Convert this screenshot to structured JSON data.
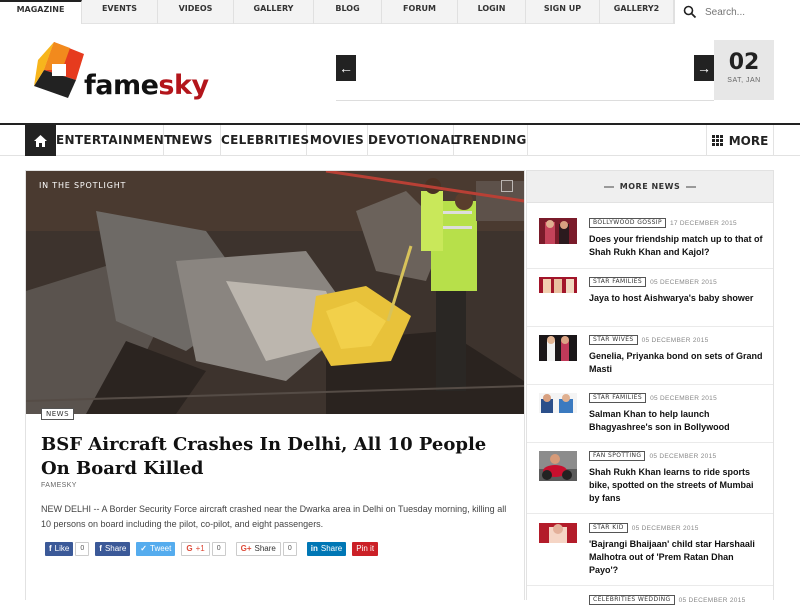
{
  "topnav": {
    "items": [
      "MAGAZINE",
      "EVENTS",
      "VIDEOS",
      "GALLERY",
      "BLOG",
      "FORUM",
      "LOGIN",
      "SIGN UP",
      "GALLERY2"
    ],
    "search_placeholder": "Search..."
  },
  "header": {
    "logo_fame": "fame",
    "logo_sky": "sky",
    "date_day": "02",
    "date_weekday": "SAT, JAN"
  },
  "mainnav": {
    "items": [
      "ENTERTAINMENT",
      "NEWS",
      "CELEBRITIES",
      "MOVIES",
      "DEVOTIONAL",
      "TRENDING"
    ],
    "more_label": "MORE"
  },
  "featured": {
    "spotlight_label": "IN THE SPOTLIGHT",
    "category": "NEWS",
    "title": "BSF Aircraft Crashes In Delhi, All 10 People On Board Killed",
    "author": "FAMESKY",
    "excerpt": "NEW DELHI -- A Border Security Force aircraft crashed near the Dwarka area in Delhi on Tuesday morning, killing all 10 persons on board including the pilot, co-pilot, and eight passengers."
  },
  "share": {
    "like_label": "Like",
    "like_count": "0",
    "fb_share_label": "Share",
    "tweet_label": "Tweet",
    "gplus_label": "+1",
    "gplus_count": "0",
    "gshare_label": "Share",
    "gshare_count": "0",
    "linkedin_label": "Share",
    "pinterest_label": "Pin it"
  },
  "more_news": {
    "heading": "MORE NEWS",
    "items": [
      {
        "category": "BOLLYWOOD GOSSIP",
        "date": "17 DECEMBER 2015",
        "title": "Does your friendship match up to that of Shah Rukh Khan and Kajol?"
      },
      {
        "category": "STAR FAMILIES",
        "date": "05 DECEMBER 2015",
        "title": "Jaya to host Aishwarya's baby shower"
      },
      {
        "category": "STAR WIVES",
        "date": "05 DECEMBER 2015",
        "title": "Genelia, Priyanka bond on sets of Grand Masti"
      },
      {
        "category": "STAR FAMILIES",
        "date": "05 DECEMBER 2015",
        "title": "Salman Khan to help launch Bhagyashree's son in Bollywood"
      },
      {
        "category": "FAN SPOTTING",
        "date": "05 DECEMBER 2015",
        "title": "Shah Rukh Khan learns to ride sports bike, spotted on the streets of Mumbai by fans"
      },
      {
        "category": "STAR KID",
        "date": "05 DECEMBER 2015",
        "title": "'Bajrangi Bhaijaan' child star Harshaali Malhotra out of 'Prem Ratan Dhan Payo'?"
      },
      {
        "category": "CELEBRITIES WEDDING",
        "date": "05 DECEMBER 2015",
        "title": ""
      }
    ]
  },
  "colors": {
    "brand_red": "#b3151b",
    "dark": "#222222",
    "facebook": "#3b5998",
    "twitter": "#55acee",
    "linkedin": "#0077b5",
    "pinterest": "#cb2027"
  }
}
